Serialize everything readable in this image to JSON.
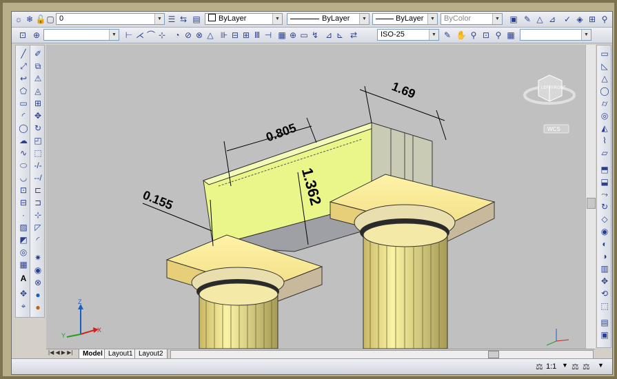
{
  "toolbar_top": {
    "layer_value": "0",
    "color_value": "ByLayer",
    "linetype_value": "ByLayer",
    "lineweight_value": "ByLayer",
    "plotstyle_value": "ByColor"
  },
  "toolbar_second": {
    "dimstyle_value": "ISO-25"
  },
  "viewcube": {
    "left_label": "LEFT",
    "front_label": "FRONT",
    "ucs_label": "WCS"
  },
  "dimensions": {
    "dim_169": "1.69",
    "dim_0805": "0.805",
    "dim_1362": "1.362",
    "dim_0155": "0.155"
  },
  "axes": {
    "x": "X",
    "y": "Y",
    "z": "Z"
  },
  "layout_tabs": [
    "Model",
    "Layout1",
    "Layout2"
  ],
  "status": {
    "scale": "1:1"
  }
}
